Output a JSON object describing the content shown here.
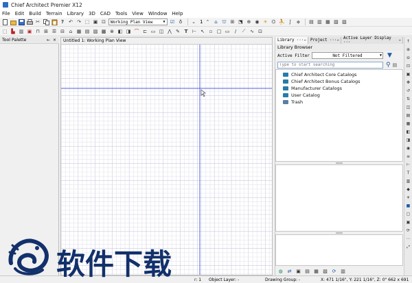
{
  "window": {
    "title": "Chief Architect Premier X12"
  },
  "menu": [
    "File",
    "Edit",
    "Build",
    "Terrain",
    "Library",
    "3D",
    "CAD",
    "Tools",
    "View",
    "Window",
    "Help"
  ],
  "toolbar": {
    "view_select": "Working Plan View",
    "floor_number": "1"
  },
  "tool_palette": {
    "title": "Tool Palette",
    "pin": "← ×"
  },
  "plan_view": {
    "tab_title": "Untitled 1:  Working Plan View"
  },
  "right_tabs": [
    {
      "label": "Library ···",
      "pin": "←"
    },
    {
      "label": "Project ···",
      "pin": "←"
    },
    {
      "label": "Active Layer Display ···",
      "pin": "←"
    }
  ],
  "library": {
    "title": "Library Browser",
    "filter_label": "Active Filter",
    "filter_value": "Not Filtered",
    "search_placeholder": "Type to start searching",
    "items": [
      {
        "label": "Chief Architect Core Catalogs",
        "icon": "catalog-icon"
      },
      {
        "label": "Chief Architect Bonus Catalogs",
        "icon": "catalog-icon"
      },
      {
        "label": "Manufacturer Catalogs",
        "icon": "catalog-icon"
      },
      {
        "label": "User Catalog",
        "icon": "catalog-icon"
      },
      {
        "label": "Trash",
        "icon": "trash-icon"
      }
    ]
  },
  "status": {
    "floor": "r: 1",
    "object_layer": "Object Layer: -",
    "drawing_group": "Drawing Group: -",
    "coords": "X: 471 1/16\", Y: 221 1/16\", Z: 0\" 662 x 691"
  },
  "watermark": {
    "text": "软件下载"
  },
  "colors": {
    "grid_minor": "#e3e3ee",
    "grid_major": "#c9c9dd",
    "axis": "#5561e0",
    "accent": "#1d5aa8",
    "watermark": "#12306b"
  }
}
